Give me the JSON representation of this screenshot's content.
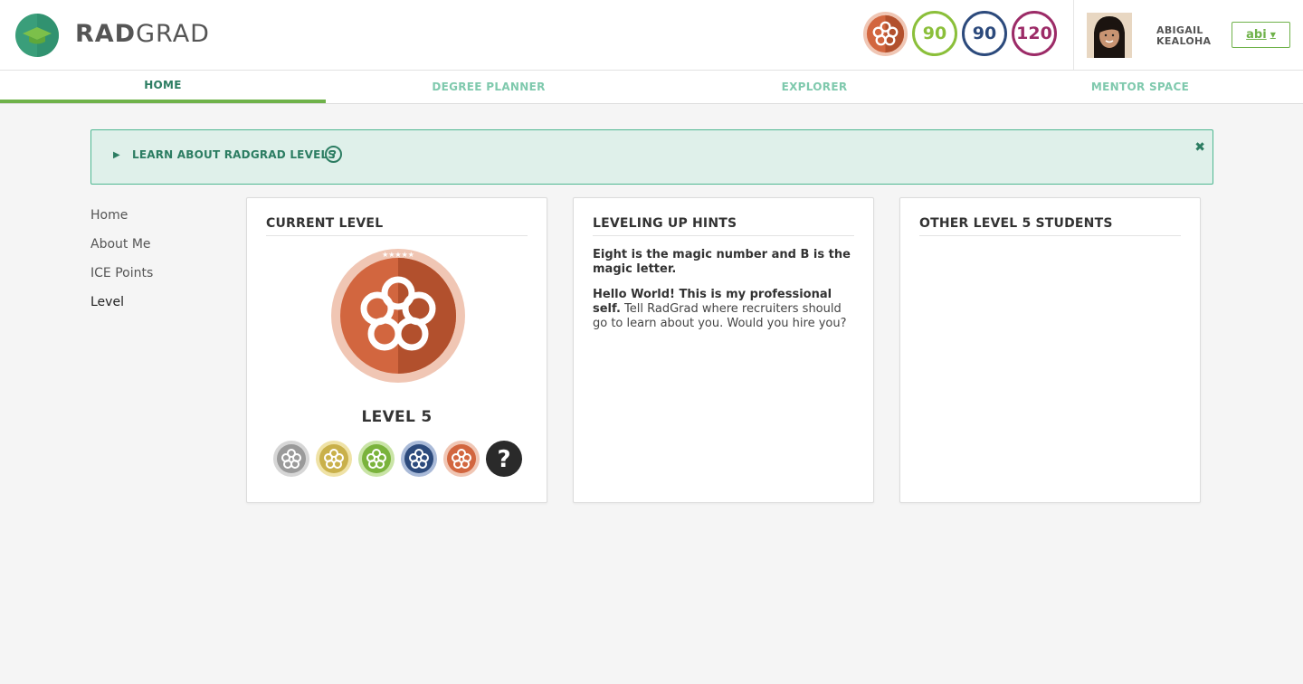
{
  "brand": {
    "rad": "RAD",
    "grad": "GRAD"
  },
  "header": {
    "ice_scores": [
      {
        "value": "90",
        "color": "#8bbf3a"
      },
      {
        "value": "90",
        "color": "#2c4a7c"
      },
      {
        "value": "120",
        "color": "#9c2b67"
      }
    ],
    "user_first": "ABIGAIL",
    "user_last": "KEALOHA",
    "account_label": "abi"
  },
  "nav": {
    "tabs": [
      {
        "label": "HOME",
        "active": true
      },
      {
        "label": "DEGREE PLANNER",
        "active": false
      },
      {
        "label": "EXPLORER",
        "active": false
      },
      {
        "label": "MENTOR SPACE",
        "active": false
      }
    ]
  },
  "banner": {
    "text": "LEARN ABOUT RADGRAD LEVELS",
    "help_glyph": "?",
    "close_glyph": "✖"
  },
  "sidebar": {
    "items": [
      {
        "label": "Home"
      },
      {
        "label": "About Me"
      },
      {
        "label": "ICE Points"
      },
      {
        "label": "Level"
      }
    ]
  },
  "current_level": {
    "title": "CURRENT LEVEL",
    "level_label": "LEVEL 5",
    "badge_colors": [
      "#9a9a9a",
      "#c9b04a",
      "#7ab33c",
      "#2c4a7c",
      "#d2663f"
    ],
    "unknown_glyph": "?"
  },
  "hints": {
    "title": "LEVELING UP HINTS",
    "hint1": "Eight is the magic number and B is the magic letter.",
    "hint2_bold": "Hello World! This is my professional self.",
    "hint2_rest": "Tell RadGrad where recruiters should go to learn about you. Would you hire you?"
  },
  "others": {
    "title": "OTHER LEVEL 5 STUDENTS"
  }
}
